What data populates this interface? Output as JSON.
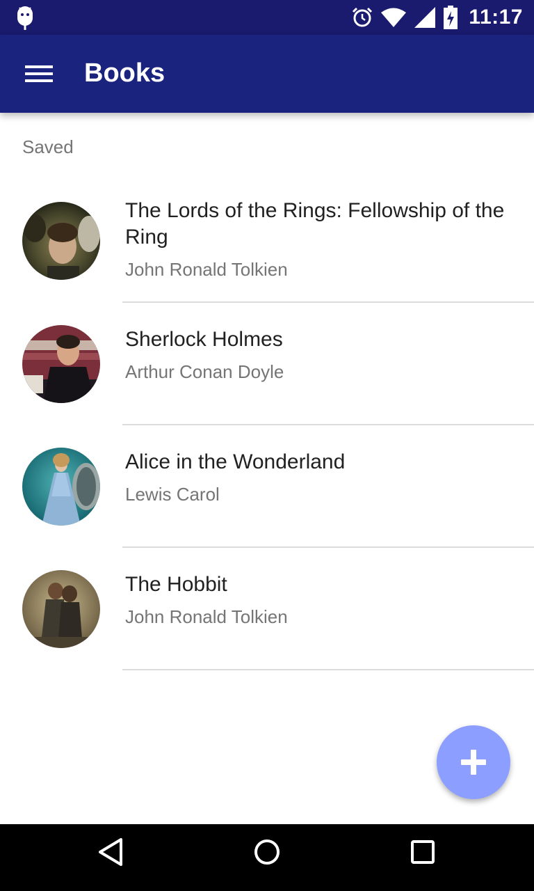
{
  "status_bar": {
    "time": "11:17",
    "icons": [
      "android-debug-icon",
      "alarm-icon",
      "wifi-icon",
      "cell-signal-icon",
      "battery-icon"
    ]
  },
  "app_bar": {
    "title": "Books",
    "menu_icon": "menu-icon"
  },
  "list": {
    "subheader": "Saved",
    "items": [
      {
        "title": "The Lords of the Rings: Fellowship of the Ring",
        "author": "John Ronald Tolkien"
      },
      {
        "title": "Sherlock Holmes",
        "author": "Arthur Conan Doyle"
      },
      {
        "title": "Alice in the Wonderland",
        "author": "Lewis Carol"
      },
      {
        "title": "The Hobbit",
        "author": "John Ronald Tolkien"
      }
    ]
  },
  "fab": {
    "icon": "add-icon",
    "color": "#8c9eff"
  },
  "nav_bar": {
    "icons": [
      "back-icon",
      "home-icon",
      "recents-icon"
    ]
  },
  "colors": {
    "primary": "#1a237e",
    "status_bar": "#1a1a6e",
    "accent": "#8c9eff"
  }
}
